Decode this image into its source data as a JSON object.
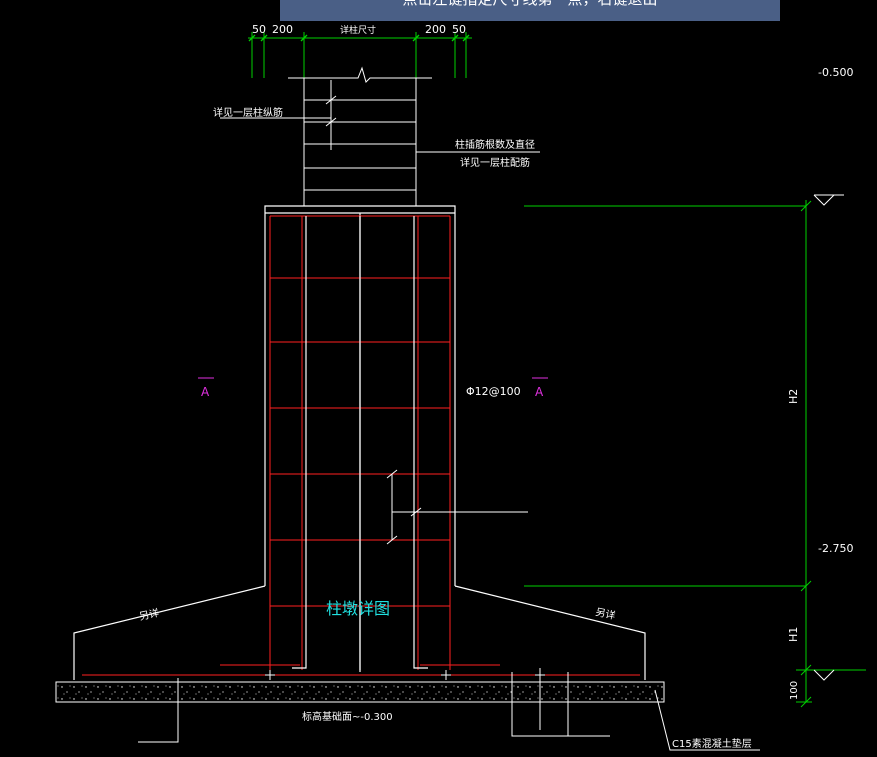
{
  "command_prompt": "点击左键指定尺寸线第一点，右键退出",
  "colors": {
    "background": "#000000",
    "lines": "#ffffff",
    "rebar": "#ff2020",
    "dimension": "#00d000",
    "section_mark": "#e030e0",
    "title": "#20e0e0",
    "prompt_bg": "#4a5f86"
  },
  "dimensions": {
    "top_left_50": "50",
    "top_left_200": "200",
    "top_center": "详柱尺寸",
    "top_right_200": "200",
    "top_right_50": "50",
    "h2_label": "H2",
    "h1_label": "H1",
    "pad_100": "100"
  },
  "elevations": {
    "top": "-0.500",
    "middle": "-2.750"
  },
  "annotations": {
    "see_first_floor_bars": "详见一层柱纵筋",
    "stirrup_note_1": "柱插筋根数及直径",
    "stirrup_note_2": "详见一层柱配筋",
    "stirrup_spec": "Φ12@100",
    "section_left": "A",
    "section_right": "A",
    "see_other_left": "另详",
    "see_other_right": "另详",
    "drawing_title": "柱墩详图",
    "foundation_top": "标高基础面~-0.300",
    "cushion_layer": "C15素混凝土垫层"
  }
}
